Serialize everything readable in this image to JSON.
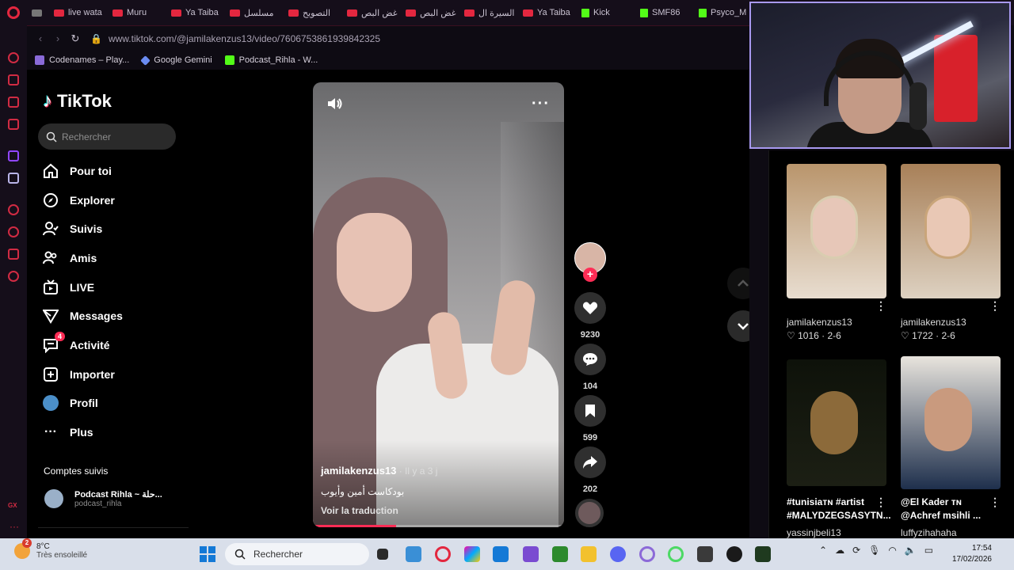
{
  "browser": {
    "tabs": [
      {
        "label": "live wata",
        "icon": "youtube-icon"
      },
      {
        "label": "Muru",
        "icon": "youtube-icon"
      },
      {
        "label": "Ya Taiba",
        "icon": "youtube-icon"
      },
      {
        "label": "مسلسل",
        "icon": "youtube-icon"
      },
      {
        "label": "التصويح",
        "icon": "youtube-icon"
      },
      {
        "label": "غض البص",
        "icon": "youtube-icon"
      },
      {
        "label": "غض البص",
        "icon": "youtube-icon"
      },
      {
        "label": "السيرة ال",
        "icon": "youtube-icon"
      },
      {
        "label": "Ya Taiba",
        "icon": "youtube-icon"
      },
      {
        "label": "Kick",
        "icon": "kick-icon"
      },
      {
        "label": "SMF86",
        "icon": "kick-icon"
      },
      {
        "label": "Psyco_M",
        "icon": "kick-icon"
      }
    ],
    "url": "www.tiktok.com/@jamilakenzus13/video/7606753861939842325",
    "bookmarks": [
      {
        "label": "Codenames – Play...",
        "color": "#8a6ad8"
      },
      {
        "label": "Google Gemini",
        "color": "#6b8cf2"
      },
      {
        "label": "Podcast_Rihla - W...",
        "color": "#53fc18"
      }
    ]
  },
  "tiktok": {
    "logo": "TikTok",
    "search_placeholder": "Rechercher",
    "nav": [
      {
        "label": "Pour toi",
        "icon": "home-icon"
      },
      {
        "label": "Explorer",
        "icon": "compass-icon"
      },
      {
        "label": "Suivis",
        "icon": "following-icon"
      },
      {
        "label": "Amis",
        "icon": "friends-icon"
      },
      {
        "label": "LIVE",
        "icon": "live-icon"
      },
      {
        "label": "Messages",
        "icon": "messages-icon"
      },
      {
        "label": "Activité",
        "icon": "activity-icon",
        "badge": "4"
      },
      {
        "label": "Importer",
        "icon": "upload-icon"
      },
      {
        "label": "Profil",
        "icon": "profile-icon"
      },
      {
        "label": "Plus",
        "icon": "more-icon"
      }
    ],
    "following_title": "Comptes suivis",
    "following_account": {
      "name": "Podcast Rihla ~ حلة...",
      "handle": "podcast_rihla"
    }
  },
  "video": {
    "author": "jamilakenzus13",
    "time_ago": " · Il y a 3 j",
    "caption": "بودكاست أمين وأيوب",
    "translate": "Voir la traduction",
    "progress": 0.33,
    "likes": "9230",
    "comments": "104",
    "saves": "599",
    "shares": "202"
  },
  "related": [
    {
      "author": "jamilakenzus13",
      "likes": "1016",
      "date": "2-6"
    },
    {
      "author": "jamilakenzus13",
      "likes": "1722",
      "date": "2-6"
    },
    {
      "title": "#tunisiaᴛɴ #artist #MALYDZEGSASYTN...",
      "author": "yassinjbeli13"
    },
    {
      "title": "@El Kader ᴛɴ @Achref msihli ...",
      "author": "luffyzihahaha"
    }
  ],
  "taskbar": {
    "weather_temp": "8°C",
    "weather_desc": "Très ensoleillé",
    "weather_badge": "2",
    "search_placeholder": "Rechercher",
    "time": "17:54",
    "date": "17/02/2026"
  }
}
